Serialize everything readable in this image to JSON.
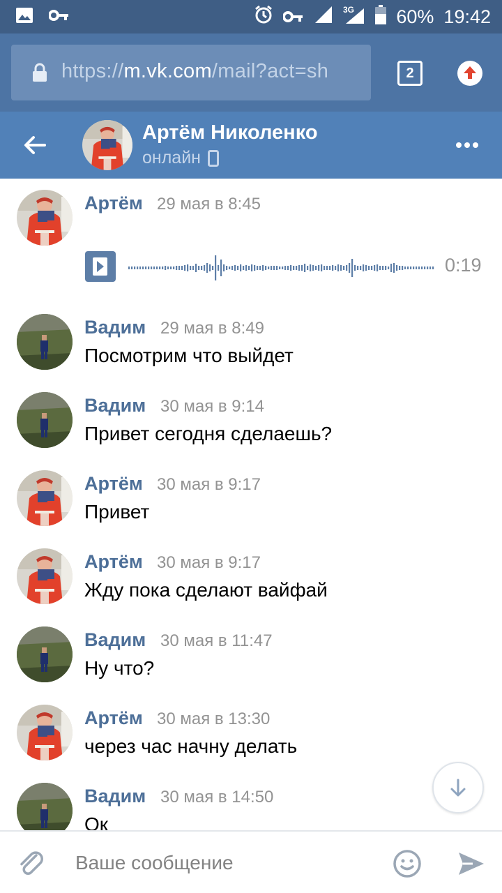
{
  "status_bar": {
    "battery": "60%",
    "time": "19:42",
    "network": "3G",
    "icons": [
      "image-icon",
      "key-icon",
      "alarm-icon",
      "key-icon",
      "signal-icon",
      "signal-3g-icon",
      "battery-icon"
    ]
  },
  "browser": {
    "url_scheme": "https://",
    "url_host": "m.vk.com",
    "url_path": "/mail?act=sh",
    "tab_count": "2"
  },
  "chat_header": {
    "name": "Артём Николенко",
    "status": "онлайн"
  },
  "messages": [
    {
      "author": "Артём",
      "time": "29 мая в 8:45",
      "type": "audio",
      "duration": "0:19"
    },
    {
      "author": "Вадим",
      "time": "29 мая в 8:49",
      "text": "Посмотрим что выйдет"
    },
    {
      "author": "Вадим",
      "time": "30 мая в 9:14",
      "text": "Привет сегодня сделаешь?"
    },
    {
      "author": "Артём",
      "time": "30 мая в 9:17",
      "text": "Привет"
    },
    {
      "author": "Артём",
      "time": "30 мая в 9:17",
      "text": "Жду пока сделают вайфай"
    },
    {
      "author": "Вадим",
      "time": "30 мая в 11:47",
      "text": "Ну что?"
    },
    {
      "author": "Артём",
      "time": "30 мая в 13:30",
      "text": "через час начну делать"
    },
    {
      "author": "Вадим",
      "time": "30 мая в 14:50",
      "text": "Ок"
    }
  ],
  "composer": {
    "placeholder": "Ваше сообщение"
  },
  "colors": {
    "status_bar": "#3f5e85",
    "url_bar": "#4d74a4",
    "header": "#5181b8",
    "name": "#4d6f98",
    "time": "#939393"
  }
}
